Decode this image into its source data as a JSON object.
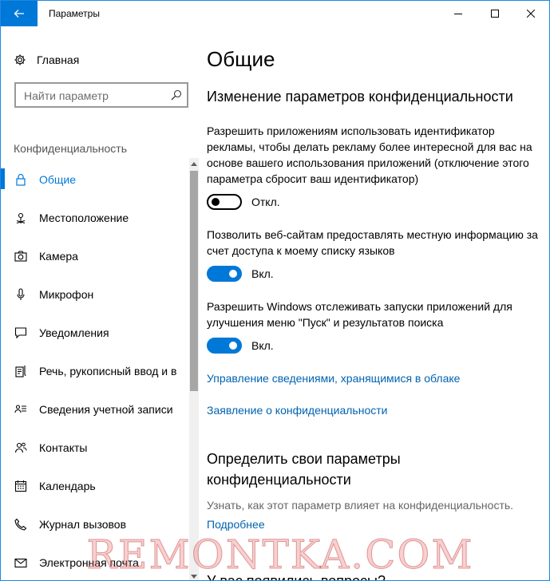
{
  "window": {
    "title": "Параметры",
    "back_icon": "arrow-left-icon",
    "accent": "#0078d7"
  },
  "sidebar": {
    "home": {
      "label": "Главная",
      "icon": "gear-icon"
    },
    "search": {
      "placeholder": "Найти параметр",
      "icon": "search-icon"
    },
    "section": "Конфиденциальность",
    "items": [
      {
        "label": "Общие",
        "icon": "lock-icon",
        "selected": true
      },
      {
        "label": "Местоположение",
        "icon": "location-icon"
      },
      {
        "label": "Камера",
        "icon": "camera-icon"
      },
      {
        "label": "Микрофон",
        "icon": "microphone-icon"
      },
      {
        "label": "Уведомления",
        "icon": "notification-icon"
      },
      {
        "label": "Речь, рукописный ввод и в",
        "icon": "speech-icon"
      },
      {
        "label": "Сведения учетной записи",
        "icon": "account-info-icon"
      },
      {
        "label": "Контакты",
        "icon": "contacts-icon"
      },
      {
        "label": "Календарь",
        "icon": "calendar-icon"
      },
      {
        "label": "Журнал вызовов",
        "icon": "call-history-icon"
      },
      {
        "label": "Электронная почта",
        "icon": "email-icon"
      }
    ]
  },
  "main": {
    "title": "Общие",
    "section1_title": "Изменение параметров конфиденциальности",
    "settings": [
      {
        "description": "Разрешить приложениям использовать идентификатор рекламы, чтобы делать рекламу более интересной для вас на основе вашего использования приложений (отключение этого параметра сбросит ваш идентификатор)",
        "state_label": "Откл.",
        "on": false
      },
      {
        "description": "Позволить веб-сайтам предоставлять местную информацию за счет доступа к моему списку языков",
        "state_label": "Вкл.",
        "on": true
      },
      {
        "description": "Разрешить Windows отслеживать запуски приложений для улучшения меню \"Пуск\" и результатов поиска",
        "state_label": "Вкл.",
        "on": true
      }
    ],
    "link_cloud": "Управление сведениями, хранящимися в облаке",
    "link_privacy": "Заявление о конфиденциальности",
    "section2_title_line1": "Определить свои параметры",
    "section2_title_line2": "конфиденциальности",
    "section2_desc": "Узнать, как этот параметр влияет на конфиденциальность.",
    "section2_link": "Подробнее",
    "section3_title": "У вас появились вопросы?"
  },
  "watermark": "REMONTKA.COM"
}
